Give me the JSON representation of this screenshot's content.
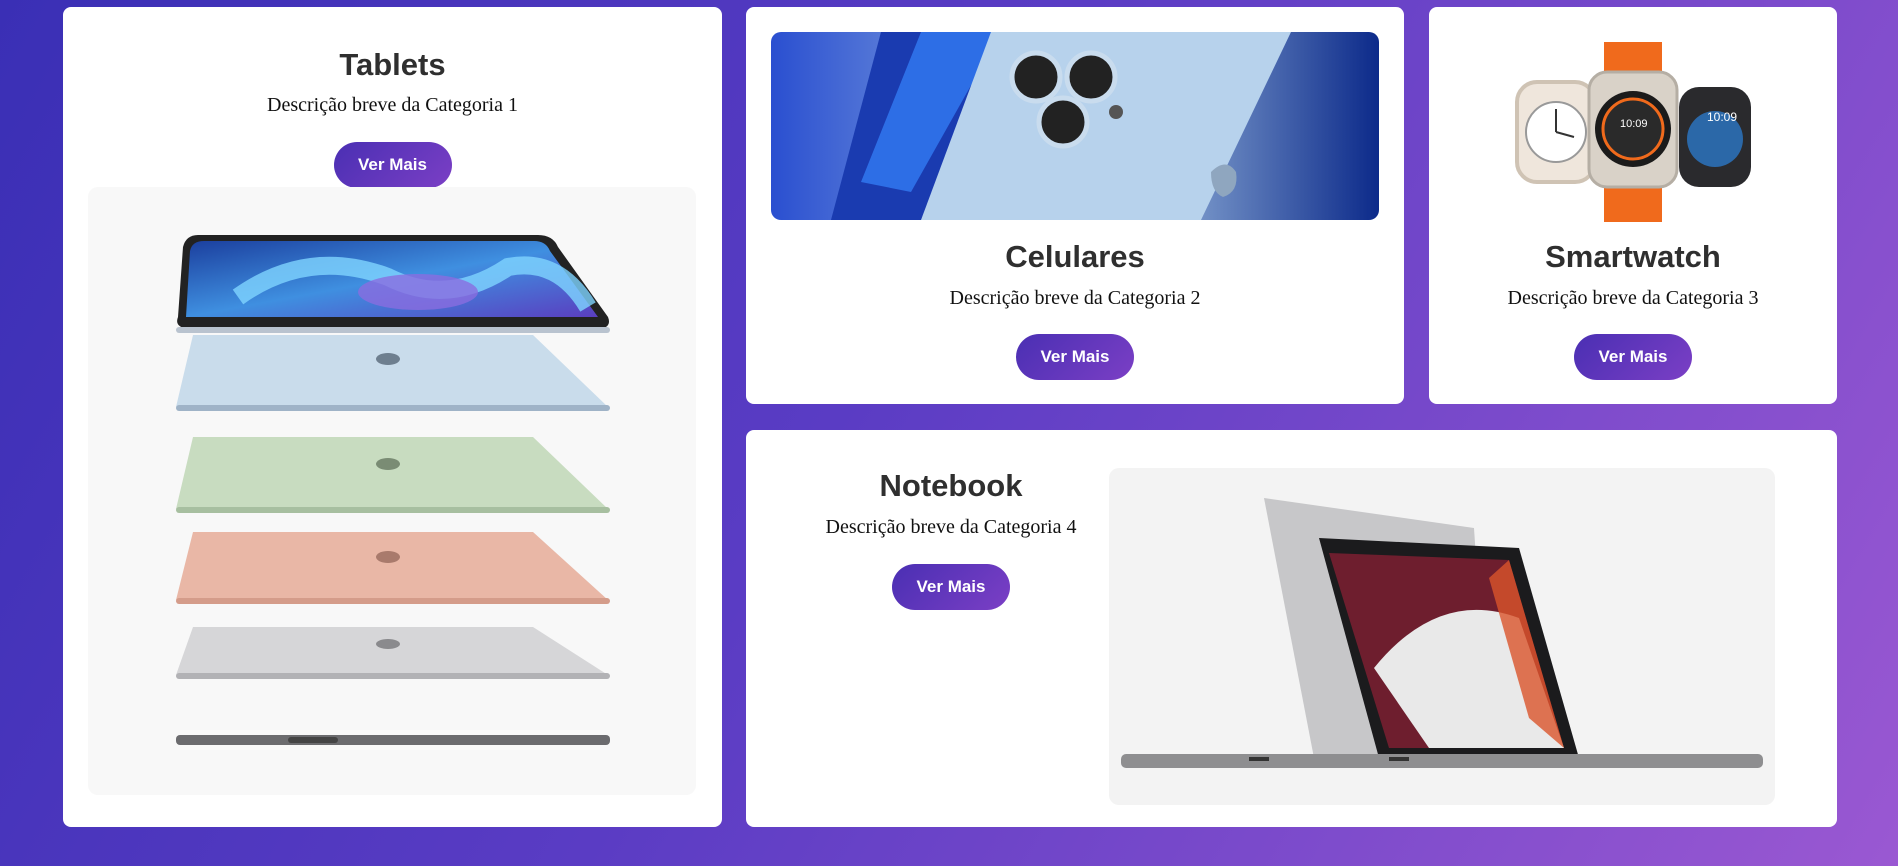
{
  "cards": [
    {
      "title": "Tablets",
      "description": "Descrição breve da Categoria 1",
      "button": "Ver Mais"
    },
    {
      "title": "Celulares",
      "description": "Descrição breve da Categoria 2",
      "button": "Ver Mais"
    },
    {
      "title": "Smartwatch",
      "description": "Descrição breve da Categoria 3",
      "button": "Ver Mais"
    },
    {
      "title": "Notebook",
      "description": "Descrição breve da Categoria 4",
      "button": "Ver Mais"
    }
  ],
  "colors": {
    "accent": "#5a33bd",
    "accent_end": "#7b3fc5",
    "card": "#ffffff"
  }
}
